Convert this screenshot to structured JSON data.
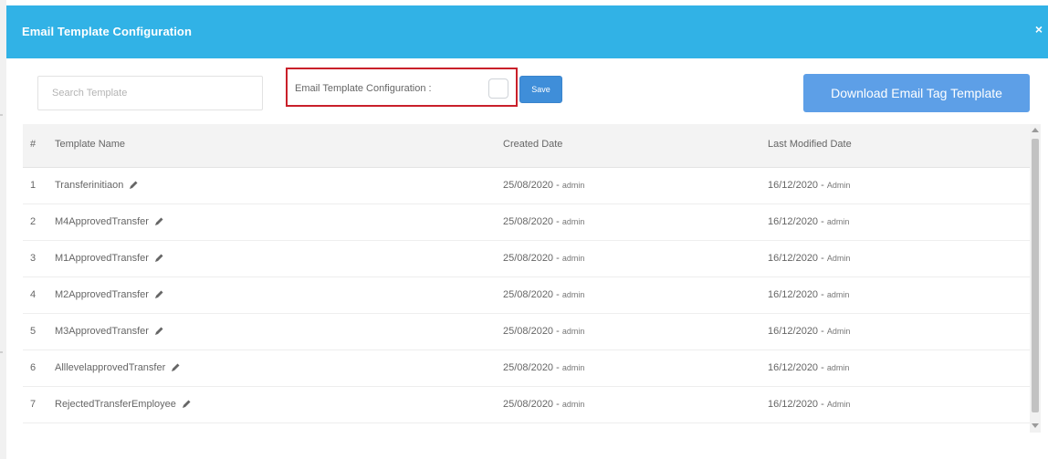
{
  "modal": {
    "title": "Email Template Configuration",
    "close_icon": "close-icon",
    "close_glyph": "×"
  },
  "toolbar": {
    "search_placeholder": "Search Template",
    "config_label": "Email Template Configuration :",
    "config_checked": false,
    "save_label": "Save",
    "download_label": "Download Email Tag Template"
  },
  "table": {
    "headers": {
      "num": "#",
      "name": "Template Name",
      "created": "Created Date",
      "modified": "Last Modified Date"
    },
    "rows": [
      {
        "num": "1",
        "name": "Transferinitiaon",
        "created_date": "25/08/2020 -",
        "created_by": "admin",
        "modified_date": "16/12/2020 -",
        "modified_by": "Admin"
      },
      {
        "num": "2",
        "name": "M4ApprovedTransfer",
        "created_date": "25/08/2020 -",
        "created_by": "admin",
        "modified_date": "16/12/2020 -",
        "modified_by": "admin"
      },
      {
        "num": "3",
        "name": "M1ApprovedTransfer",
        "created_date": "25/08/2020 -",
        "created_by": "admin",
        "modified_date": "16/12/2020 -",
        "modified_by": "Admin"
      },
      {
        "num": "4",
        "name": "M2ApprovedTransfer",
        "created_date": "25/08/2020 -",
        "created_by": "admin",
        "modified_date": "16/12/2020 -",
        "modified_by": "admin"
      },
      {
        "num": "5",
        "name": "M3ApprovedTransfer",
        "created_date": "25/08/2020 -",
        "created_by": "admin",
        "modified_date": "16/12/2020 -",
        "modified_by": "Admin"
      },
      {
        "num": "6",
        "name": "AlllevelapprovedTransfer",
        "created_date": "25/08/2020 -",
        "created_by": "admin",
        "modified_date": "16/12/2020 -",
        "modified_by": "admin"
      },
      {
        "num": "7",
        "name": "RejectedTransferEmployee",
        "created_date": "25/08/2020 -",
        "created_by": "admin",
        "modified_date": "16/12/2020 -",
        "modified_by": "Admin"
      }
    ],
    "row_edit_icon": "pencil-icon"
  },
  "colors": {
    "header": "#31b2e6",
    "download_button": "#5d9fe7",
    "save_button": "#3f8ed9",
    "highlight_border": "#c9202a"
  }
}
